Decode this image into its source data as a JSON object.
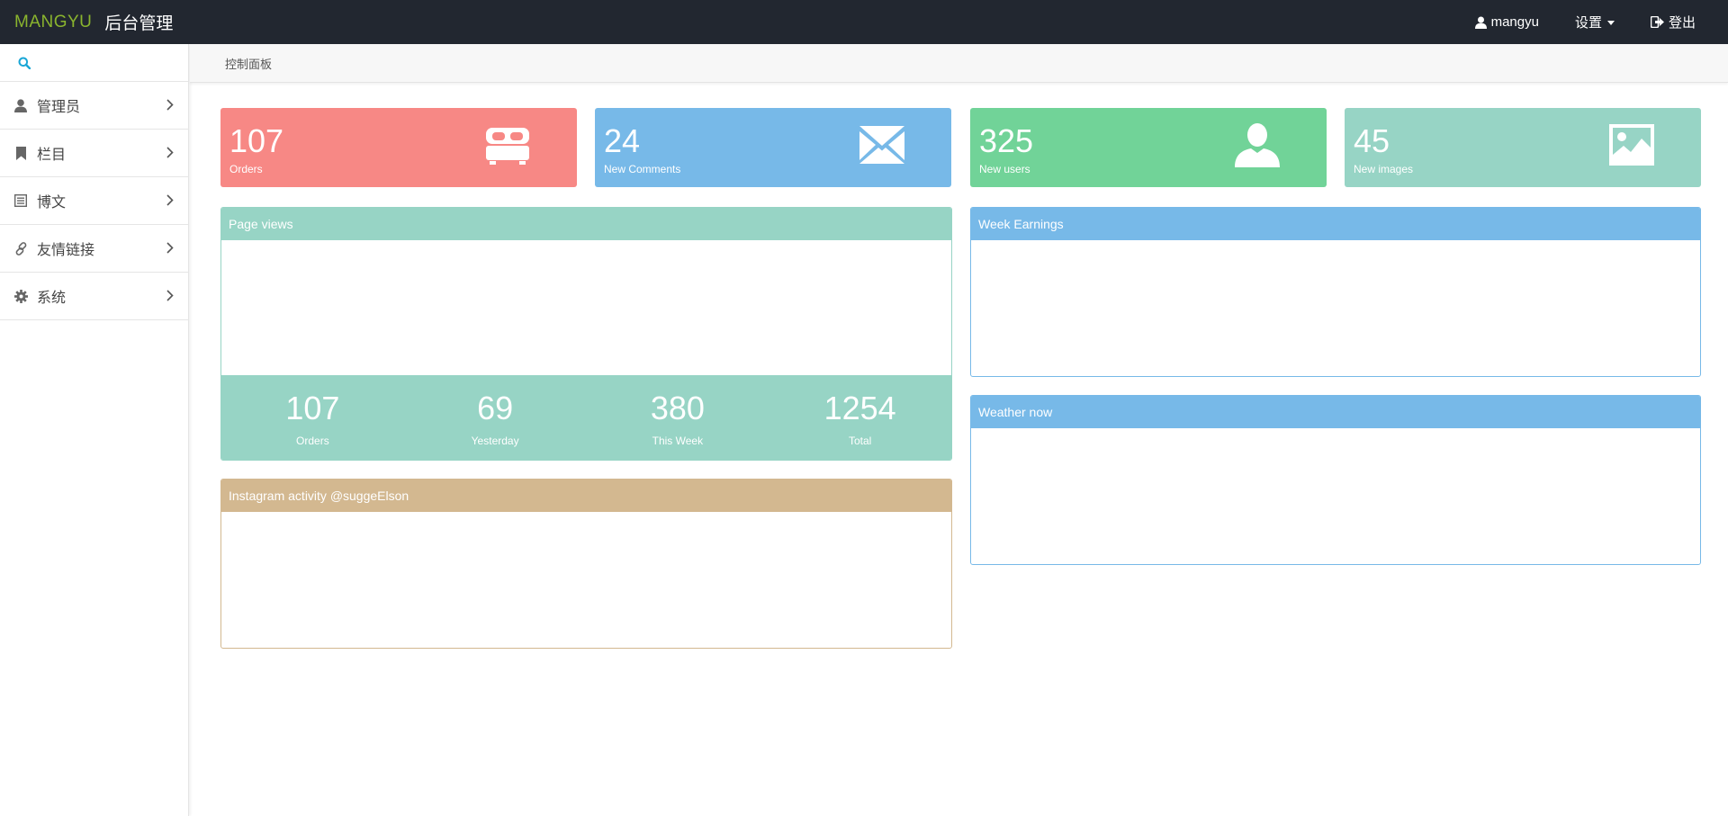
{
  "header": {
    "logo": "MANGYU",
    "title": "后台管理",
    "user": "mangyu",
    "settings": "设置",
    "logout": "登出"
  },
  "sidebar": {
    "items": [
      {
        "label": "管理员",
        "icon": "user-icon"
      },
      {
        "label": "栏目",
        "icon": "bookmark-icon"
      },
      {
        "label": "博文",
        "icon": "list-alt-icon"
      },
      {
        "label": "友情链接",
        "icon": "link-icon"
      },
      {
        "label": "系统",
        "icon": "gear-icon"
      }
    ]
  },
  "breadcrumb": "控制面板",
  "tiles": [
    {
      "value": "107",
      "label": "Orders",
      "icon": "bed-icon",
      "color": "#f78885"
    },
    {
      "value": "24",
      "label": "New Comments",
      "icon": "envelope-icon",
      "color": "#77b9e8"
    },
    {
      "value": "325",
      "label": "New users",
      "icon": "user-icon",
      "color": "#71d398"
    },
    {
      "value": "45",
      "label": "New images",
      "icon": "picture-icon",
      "color": "#97d4c5"
    }
  ],
  "panels": {
    "page_views": {
      "title": "Page views",
      "color": "#97d4c5",
      "stats": [
        {
          "value": "107",
          "label": "Orders"
        },
        {
          "value": "69",
          "label": "Yesterday"
        },
        {
          "value": "380",
          "label": "This Week"
        },
        {
          "value": "1254",
          "label": "Total"
        }
      ]
    },
    "instagram": {
      "title": "Instagram activity @suggeElson",
      "color": "#d3b890"
    },
    "week_earnings": {
      "title": "Week Earnings",
      "color": "#77b9e8"
    },
    "weather": {
      "title": "Weather now",
      "color": "#77b9e8"
    }
  }
}
